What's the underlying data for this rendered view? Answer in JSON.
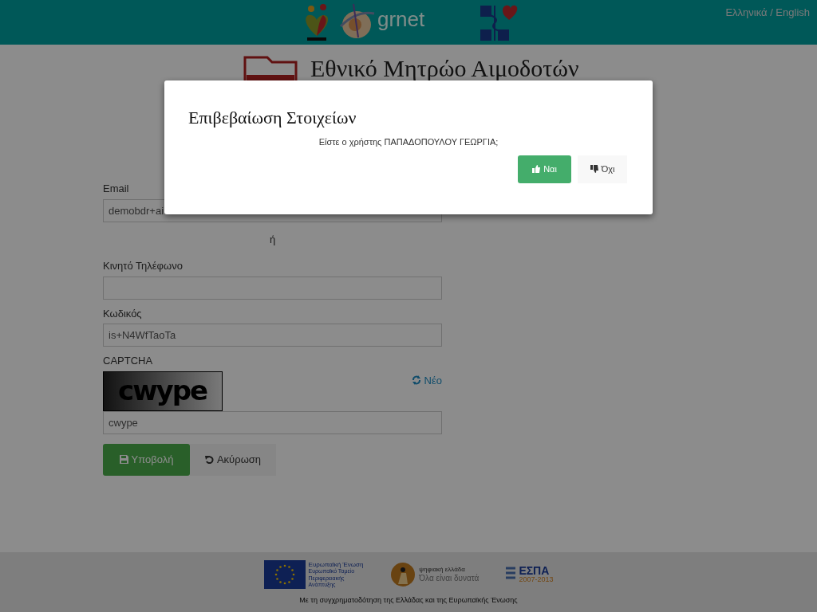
{
  "header": {
    "logos": [
      {
        "kind": "heart"
      },
      {
        "kind": "globe",
        "text": "grnet"
      },
      {
        "kind": "cross"
      }
    ],
    "language_link": "Ελληνικά / English"
  },
  "brand": {
    "title": "Εθνικό Μητρώο Αιμοδοτών"
  },
  "form": {
    "fields": [
      {
        "kind": "input",
        "label": "Email",
        "value": "demobdr+ai"
      },
      {
        "kind": "separator",
        "text": "ή"
      },
      {
        "kind": "input",
        "label": "Κινητό Τηλέφωνο"
      },
      {
        "kind": "input",
        "label": "Κωδικός",
        "value": "is+N4WfTaoTa"
      },
      {
        "kind": "captcha",
        "label": "CAPTCHA",
        "captcha_text": "cwype",
        "refresh": "Νέο",
        "value": "cwype"
      }
    ],
    "buttons": [
      {
        "kind": "submit",
        "label": "Υποβολή"
      },
      {
        "kind": "cancel",
        "label": "Ακύρωση"
      }
    ]
  },
  "footer": {
    "eu": {
      "title": "Ευρωπαϊκή Ένωση",
      "subtitle": "Ευρωπαϊκό Ταμείο Περιφερειακής Ανάπτυξης"
    },
    "digital": {
      "title": "ψηφιακή ελλάδα",
      "slogan": "Όλα είναι δυνατά"
    },
    "espa": {
      "title": "ΕΣΠΑ",
      "years": "2007-2013"
    },
    "note": "Με τη συγχρηματοδότηση της Ελλάδας και της Ευρωπαϊκής Ένωσης"
  },
  "modal": {
    "title": "Επιβεβαίωση Στοιχείων",
    "message": "Είστε ο χρήστης ΠΑΠΑΔΟΠΟΥΛΟΥ ΓΕΩΡΓΙΑ;",
    "buttons": [
      {
        "kind": "yes",
        "label": "Ναι"
      },
      {
        "kind": "no",
        "label": "Όχι"
      }
    ]
  }
}
